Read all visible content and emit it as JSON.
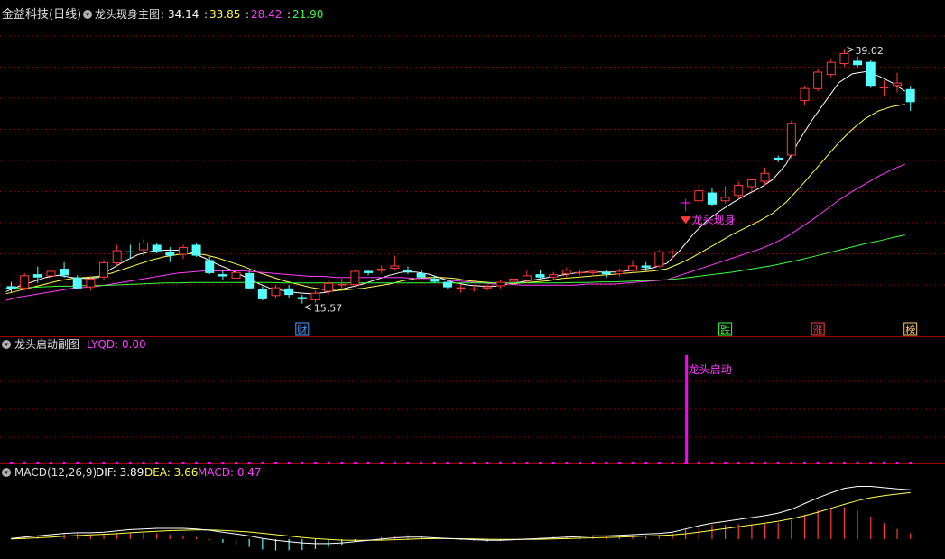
{
  "colors": {
    "up": "#ff3b3b",
    "down": "#54ffff",
    "ma1": "#ffffff",
    "ma2": "#ffff4a",
    "ma3": "#ff3bff",
    "ma4": "#3bff3b",
    "grid": "#8a0000",
    "magenta": "#ff00ff"
  },
  "main_panel": {
    "stock": "金益科技(日线)",
    "indicator": "龙头现身主图",
    "sep": ":",
    "ma_values": [
      "34.14",
      "33.85",
      "28.42",
      "21.90"
    ],
    "high_label": "39.02",
    "low_label": "15.57",
    "signal_text": "龙头现身",
    "events": [
      {
        "label": "财",
        "bar": 22,
        "color": "#4aa0ff"
      },
      {
        "label": "跌",
        "bar": 54,
        "color": "#3bff3b"
      },
      {
        "label": "涨",
        "bar": 61,
        "color": "#ff3b3b"
      },
      {
        "label": "榜",
        "bar": 68,
        "color": "#ffcc66"
      }
    ]
  },
  "sub_panel": {
    "title": "龙头启动副图",
    "reading": "LYQD: 0.00",
    "signal_text": "龙头启动",
    "signal_bar": 51
  },
  "macd_panel": {
    "title": "MACD(12,26,9)",
    "dif": "DIF: 3.89",
    "dea": "DEA: 3.66",
    "macd": "MACD: 0.47"
  },
  "chart_data": {
    "type": "candlestick",
    "ylim": [
      14.5,
      41.0
    ],
    "candles": [
      [
        17.2,
        17.6,
        16.6,
        16.9
      ],
      [
        17.0,
        18.4,
        16.8,
        18.2
      ],
      [
        18.3,
        19.0,
        17.5,
        18.0
      ],
      [
        18.1,
        19.2,
        17.9,
        18.6
      ],
      [
        18.8,
        19.4,
        18.0,
        18.2
      ],
      [
        18.0,
        18.2,
        16.9,
        17.0
      ],
      [
        17.1,
        18.0,
        16.8,
        17.9
      ],
      [
        18.0,
        19.6,
        17.7,
        19.4
      ],
      [
        19.3,
        21.0,
        19.1,
        20.5
      ],
      [
        20.4,
        21.0,
        19.8,
        20.3
      ],
      [
        20.5,
        21.5,
        20.0,
        21.2
      ],
      [
        21.0,
        21.2,
        20.2,
        20.4
      ],
      [
        20.3,
        20.8,
        19.4,
        20.0
      ],
      [
        20.1,
        21.0,
        19.7,
        20.8
      ],
      [
        21.0,
        21.2,
        19.9,
        20.0
      ],
      [
        19.6,
        19.9,
        18.3,
        18.4
      ],
      [
        18.3,
        18.6,
        17.8,
        18.1
      ],
      [
        17.9,
        18.9,
        17.5,
        18.5
      ],
      [
        18.4,
        18.6,
        16.9,
        17.0
      ],
      [
        16.9,
        17.2,
        15.9,
        16.0
      ],
      [
        16.3,
        17.3,
        16.1,
        17.1
      ],
      [
        17.0,
        17.3,
        16.1,
        16.4
      ],
      [
        16.2,
        16.4,
        15.6,
        16.0
      ],
      [
        15.9,
        16.8,
        15.7,
        16.6
      ],
      [
        16.7,
        17.7,
        16.4,
        17.5
      ],
      [
        17.4,
        17.9,
        17.0,
        17.4
      ],
      [
        17.3,
        18.7,
        17.1,
        18.6
      ],
      [
        18.6,
        18.7,
        18.2,
        18.4
      ],
      [
        18.6,
        19.1,
        18.4,
        18.8
      ],
      [
        18.8,
        20.0,
        18.6,
        19.1
      ],
      [
        18.7,
        19.0,
        18.3,
        18.5
      ],
      [
        18.4,
        18.6,
        17.9,
        18.0
      ],
      [
        17.9,
        18.2,
        17.5,
        17.6
      ],
      [
        17.6,
        17.8,
        16.9,
        17.1
      ],
      [
        17.1,
        17.4,
        16.6,
        17.1
      ],
      [
        17.0,
        17.3,
        16.7,
        17.0
      ],
      [
        17.0,
        17.3,
        16.8,
        17.2
      ],
      [
        17.2,
        17.8,
        17.0,
        17.6
      ],
      [
        17.6,
        18.0,
        17.2,
        17.9
      ],
      [
        17.7,
        18.6,
        17.5,
        18.2
      ],
      [
        18.3,
        18.7,
        17.9,
        18.0
      ],
      [
        18.0,
        18.5,
        17.8,
        18.3
      ],
      [
        18.3,
        18.9,
        18.0,
        18.7
      ],
      [
        18.5,
        18.7,
        18.2,
        18.5
      ],
      [
        18.4,
        18.7,
        18.1,
        18.6
      ],
      [
        18.5,
        18.7,
        18.0,
        18.3
      ],
      [
        18.3,
        18.8,
        18.1,
        18.6
      ],
      [
        18.6,
        19.6,
        18.4,
        19.1
      ],
      [
        19.1,
        19.4,
        18.6,
        18.9
      ],
      [
        19.0,
        20.5,
        18.9,
        20.4
      ],
      [
        20.3,
        20.6,
        19.7,
        20.4
      ],
      [
        24.9,
        25.2,
        24.1,
        24.8
      ],
      [
        25.0,
        26.6,
        24.8,
        26.0
      ],
      [
        25.8,
        26.2,
        24.6,
        24.7
      ],
      [
        25.0,
        26.4,
        24.8,
        25.4
      ],
      [
        25.5,
        26.8,
        25.2,
        26.5
      ],
      [
        26.3,
        27.1,
        25.9,
        27.0
      ],
      [
        26.8,
        28.1,
        26.5,
        27.6
      ],
      [
        29.0,
        29.2,
        28.6,
        28.8
      ],
      [
        29.2,
        32.4,
        28.9,
        32.2
      ],
      [
        34.2,
        35.6,
        33.8,
        35.4
      ],
      [
        35.3,
        37.1,
        35.1,
        36.9
      ],
      [
        36.6,
        38.1,
        36.4,
        37.8
      ],
      [
        37.6,
        39.0,
        37.4,
        38.6
      ],
      [
        37.9,
        38.3,
        37.3,
        37.5
      ],
      [
        37.8,
        38.0,
        35.4,
        35.6
      ],
      [
        35.4,
        36.1,
        34.6,
        35.5
      ],
      [
        35.6,
        36.8,
        35.0,
        35.9
      ],
      [
        35.3,
        35.6,
        33.3,
        34.1
      ]
    ],
    "ma_lines": [
      {
        "name": "MA1",
        "values": [
          16.7,
          17.2,
          17.6,
          18.0,
          18.2,
          18.0,
          17.9,
          18.0,
          18.8,
          19.5,
          20.1,
          20.4,
          20.5,
          20.5,
          20.3,
          19.8,
          19.2,
          18.7,
          18.1,
          17.5,
          17.0,
          16.8,
          16.6,
          16.5,
          16.6,
          16.8,
          17.1,
          17.4,
          17.8,
          18.2,
          18.5,
          18.5,
          18.3,
          17.9,
          17.5,
          17.3,
          17.2,
          17.2,
          17.4,
          17.6,
          17.8,
          18.0,
          18.2,
          18.4,
          18.5,
          18.5,
          18.5,
          18.6,
          18.7,
          18.9,
          19.3,
          20.5,
          22.0,
          23.2,
          24.1,
          24.9,
          25.6,
          26.2,
          27.0,
          28.4,
          30.6,
          32.5,
          34.2,
          35.9,
          36.7,
          36.9,
          36.5,
          35.9,
          35.1
        ]
      },
      {
        "name": "MA2",
        "values": [
          16.5,
          16.8,
          17.1,
          17.4,
          17.7,
          17.9,
          18.0,
          18.1,
          18.4,
          18.8,
          19.2,
          19.6,
          19.9,
          20.1,
          20.2,
          20.1,
          19.8,
          19.4,
          19.0,
          18.5,
          18.1,
          17.7,
          17.4,
          17.1,
          16.9,
          16.8,
          16.9,
          17.0,
          17.2,
          17.4,
          17.7,
          17.9,
          18.0,
          18.0,
          17.9,
          17.7,
          17.6,
          17.5,
          17.4,
          17.5,
          17.6,
          17.7,
          17.9,
          18.0,
          18.1,
          18.2,
          18.3,
          18.4,
          18.5,
          18.6,
          18.8,
          19.3,
          19.9,
          20.6,
          21.3,
          22.0,
          22.6,
          23.2,
          23.9,
          24.9,
          26.2,
          27.6,
          29.0,
          30.4,
          31.6,
          32.6,
          33.3,
          33.7,
          33.9
        ]
      },
      {
        "name": "MA3",
        "values": [
          15.9,
          16.2,
          16.4,
          16.6,
          16.8,
          17.0,
          17.1,
          17.2,
          17.4,
          17.6,
          17.8,
          18.0,
          18.2,
          18.4,
          18.5,
          18.6,
          18.6,
          18.6,
          18.6,
          18.5,
          18.4,
          18.3,
          18.2,
          18.1,
          18.1,
          18.0,
          18.0,
          18.0,
          18.0,
          18.0,
          18.0,
          17.9,
          17.9,
          17.8,
          17.7,
          17.6,
          17.5,
          17.4,
          17.4,
          17.3,
          17.3,
          17.3,
          17.3,
          17.3,
          17.4,
          17.4,
          17.4,
          17.5,
          17.6,
          17.7,
          17.8,
          18.2,
          18.6,
          19.0,
          19.4,
          19.8,
          20.2,
          20.6,
          21.1,
          21.7,
          22.5,
          23.3,
          24.2,
          25.1,
          25.9,
          26.6,
          27.3,
          27.9,
          28.4
        ]
      },
      {
        "name": "MA4",
        "values": [
          17.0,
          17.05,
          17.1,
          17.15,
          17.2,
          17.2,
          17.25,
          17.25,
          17.3,
          17.35,
          17.4,
          17.45,
          17.5,
          17.5,
          17.55,
          17.55,
          17.55,
          17.55,
          17.55,
          17.55,
          17.55,
          17.5,
          17.5,
          17.5,
          17.5,
          17.5,
          17.5,
          17.5,
          17.5,
          17.5,
          17.5,
          17.5,
          17.5,
          17.5,
          17.5,
          17.5,
          17.5,
          17.5,
          17.5,
          17.5,
          17.5,
          17.5,
          17.5,
          17.55,
          17.55,
          17.6,
          17.6,
          17.65,
          17.7,
          17.75,
          17.8,
          17.9,
          18.05,
          18.2,
          18.35,
          18.5,
          18.7,
          18.9,
          19.1,
          19.35,
          19.6,
          19.9,
          20.2,
          20.5,
          20.8,
          21.1,
          21.35,
          21.65,
          21.9
        ]
      }
    ],
    "macd": {
      "ylim": [
        -1.0,
        4.4
      ],
      "dif": [
        0.05,
        0.15,
        0.25,
        0.35,
        0.45,
        0.5,
        0.5,
        0.55,
        0.65,
        0.75,
        0.8,
        0.85,
        0.85,
        0.85,
        0.8,
        0.7,
        0.55,
        0.4,
        0.25,
        0.05,
        -0.1,
        -0.2,
        -0.3,
        -0.35,
        -0.35,
        -0.3,
        -0.2,
        -0.1,
        0.0,
        0.1,
        0.15,
        0.15,
        0.1,
        0.05,
        0.0,
        -0.05,
        -0.1,
        -0.1,
        -0.05,
        0.0,
        0.05,
        0.1,
        0.15,
        0.2,
        0.25,
        0.25,
        0.3,
        0.35,
        0.4,
        0.45,
        0.55,
        0.8,
        1.05,
        1.25,
        1.4,
        1.55,
        1.7,
        1.85,
        2.05,
        2.35,
        2.8,
        3.25,
        3.65,
        4.0,
        4.15,
        4.15,
        4.05,
        3.95,
        3.89
      ],
      "dea": [
        0.0,
        0.05,
        0.1,
        0.15,
        0.22,
        0.28,
        0.33,
        0.38,
        0.43,
        0.5,
        0.56,
        0.62,
        0.67,
        0.7,
        0.72,
        0.72,
        0.69,
        0.63,
        0.56,
        0.46,
        0.35,
        0.24,
        0.13,
        0.04,
        -0.03,
        -0.08,
        -0.1,
        -0.1,
        -0.08,
        -0.05,
        -0.01,
        0.02,
        0.04,
        0.04,
        0.03,
        0.01,
        -0.01,
        -0.03,
        -0.03,
        -0.03,
        -0.01,
        0.01,
        0.04,
        0.07,
        0.1,
        0.13,
        0.16,
        0.2,
        0.24,
        0.28,
        0.33,
        0.42,
        0.55,
        0.69,
        0.83,
        0.97,
        1.11,
        1.26,
        1.41,
        1.6,
        1.84,
        2.12,
        2.43,
        2.74,
        3.03,
        3.26,
        3.42,
        3.55,
        3.66
      ]
    }
  }
}
